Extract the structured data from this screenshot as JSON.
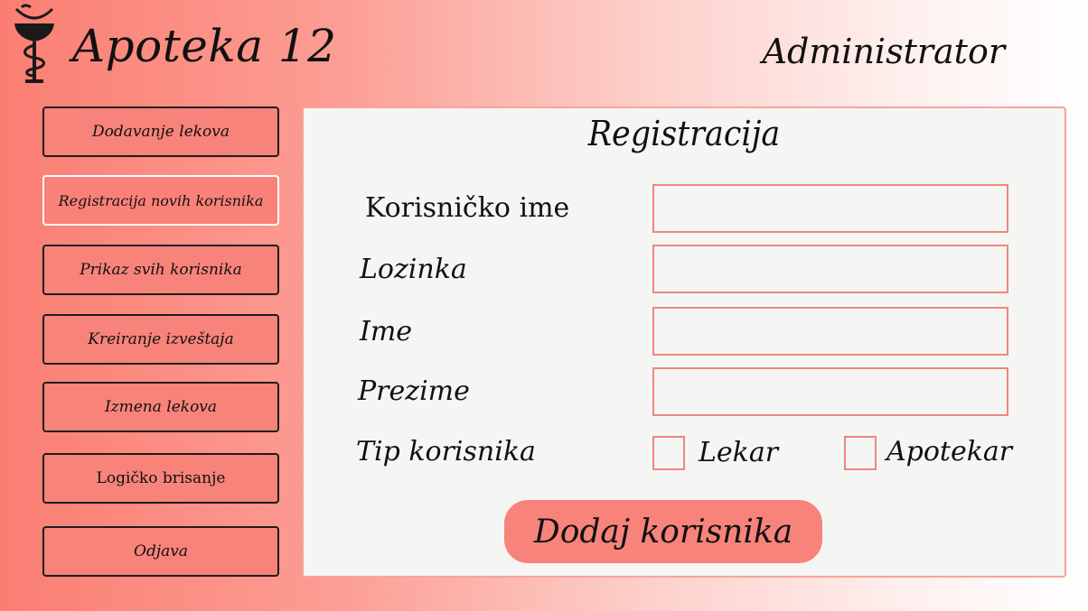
{
  "header": {
    "logo_icon": "caduceus-bowl-icon",
    "app_title": "Apoteka 12",
    "role": "Administrator"
  },
  "sidebar": {
    "items": [
      {
        "label": "Dodavanje lekova"
      },
      {
        "label": "Registracija novih korisnika",
        "active": true
      },
      {
        "label": "Prikaz svih korisnika"
      },
      {
        "label": "Kreiranje izveštaja"
      },
      {
        "label": "Izmena lekova"
      },
      {
        "label": "Logičko brisanje"
      },
      {
        "label": "Odjava"
      }
    ]
  },
  "form": {
    "title": "Registracija",
    "fields": {
      "username": {
        "label": "Korisničko ime",
        "value": ""
      },
      "password": {
        "label": "Lozinka",
        "value": ""
      },
      "first_name": {
        "label": "Ime",
        "value": ""
      },
      "last_name": {
        "label": "Prezime",
        "value": ""
      }
    },
    "user_type": {
      "label": "Tip korisnika",
      "options": [
        {
          "label": "Lekar",
          "checked": false
        },
        {
          "label": "Apotekar",
          "checked": false
        }
      ]
    },
    "submit_label": "Dodaj korisnika"
  },
  "colors": {
    "accent": "#f8837a",
    "panel_background": "#f5f6f3",
    "input_border": "#f0867d"
  }
}
